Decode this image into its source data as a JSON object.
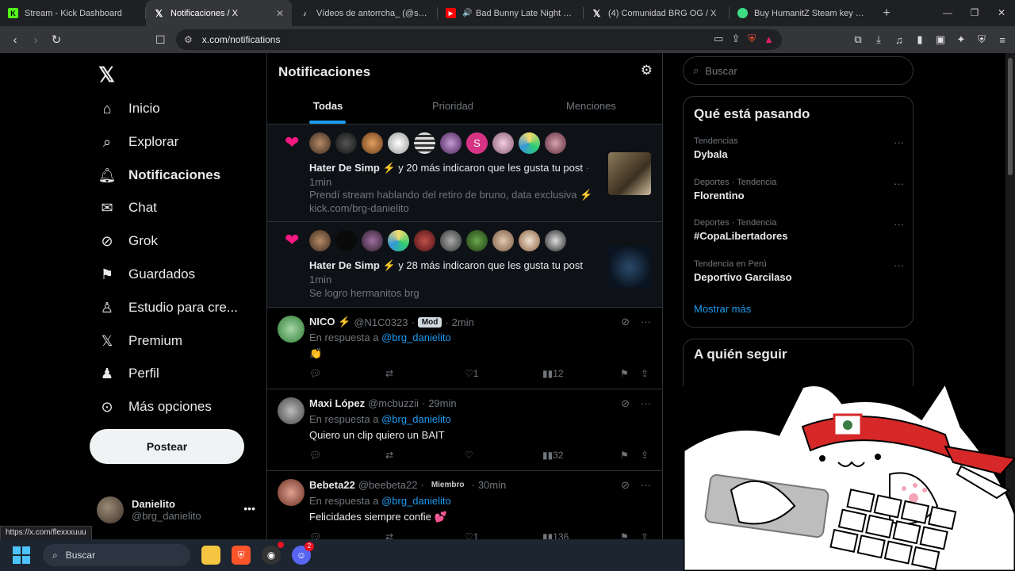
{
  "browser": {
    "tabs": [
      {
        "title": "Stream - Kick Dashboard",
        "icon": "kick-icon",
        "color": "#53fc18"
      },
      {
        "title": "Notificaciones / X",
        "icon": "x-icon",
        "color": "#ffffff",
        "active": true
      },
      {
        "title": "Vídeos de antorrcha_ (@seguidores)",
        "icon": "tiktok-icon",
        "color": "#ffffff"
      },
      {
        "title": "Bad Bunny Late Night Drive",
        "icon": "youtube-icon",
        "color": "#ff0000"
      },
      {
        "title": "(4) Comunidad BRG OG / X",
        "icon": "x-icon",
        "color": "#ffffff"
      },
      {
        "title": "Buy HumanitZ Steam key PC! Ch",
        "icon": "store-icon",
        "color": "#3ddc84"
      }
    ],
    "url": "x.com/notifications",
    "status_link": "https://x.com/flexxxuuu"
  },
  "nav": {
    "logo": "X",
    "items": [
      {
        "label": "Inicio",
        "icon": "home-icon"
      },
      {
        "label": "Explorar",
        "icon": "search-icon"
      },
      {
        "label": "Notificaciones",
        "icon": "bell-icon"
      },
      {
        "label": "Chat",
        "icon": "mail-icon"
      },
      {
        "label": "Grok",
        "icon": "grok-icon"
      },
      {
        "label": "Guardados",
        "icon": "bookmark-icon"
      },
      {
        "label": "Estudio para cre...",
        "icon": "studio-icon"
      },
      {
        "label": "Premium",
        "icon": "x-premium-icon"
      },
      {
        "label": "Perfil",
        "icon": "person-icon"
      },
      {
        "label": "Más opciones",
        "icon": "more-circle-icon"
      }
    ],
    "post_button": "Postear",
    "profile": {
      "name": "Danielito",
      "handle": "@brg_danielito"
    }
  },
  "main": {
    "title": "Notificaciones",
    "tabs": [
      "Todas",
      "Prioridad",
      "Menciones"
    ],
    "notifications": [
      {
        "type": "like",
        "actor": "Hater De Simp ⚡",
        "action": " y 20 más indicaron que les gusta tu post",
        "time": "1min",
        "text": "Prendí stream hablando del retiro de bruno, data exclusiva ⚡",
        "text2": "kick.com/brg-danielito"
      },
      {
        "type": "like",
        "actor": "Hater De Simp ⚡",
        "action": " y 28 más indicaron que les gusta tu post",
        "time": "1min",
        "text": "Se logro hermanitos brg"
      }
    ],
    "replies": [
      {
        "name": "NICO ⚡",
        "handle": "@N1C0323",
        "badge": "Mod",
        "time": "2min",
        "reply_to": "@brg_danielito",
        "text": "👏",
        "replies": "",
        "retweets": "",
        "likes": "1",
        "views": "12"
      },
      {
        "name": "Maxi López",
        "handle": "@mcbuzzii",
        "badge": "",
        "time": "29min",
        "reply_to": "@brg_danielito",
        "text": "Quiero un clip quiero un BAIT",
        "replies": "",
        "retweets": "",
        "likes": "",
        "views": "32"
      },
      {
        "name": "Bebeta22",
        "handle": "@beebeta22",
        "badge": "Miembro",
        "time": "30min",
        "reply_to": "@brg_danielito",
        "text": "Felicidades siempre confie 💕",
        "replies": "",
        "retweets": "",
        "likes": "1",
        "views": "136"
      }
    ],
    "reply_prefix": "En respuesta a "
  },
  "sidebar": {
    "search_placeholder": "Buscar",
    "trends_title": "Qué está pasando",
    "trends": [
      {
        "meta": "Tendencias",
        "name": "Dybala"
      },
      {
        "meta": "Deportes · Tendencia",
        "name": "Florentino"
      },
      {
        "meta": "Deportes · Tendencia",
        "name": "#CopaLibertadores"
      },
      {
        "meta": "Tendencia en Perú",
        "name": "Deportivo Garcilaso"
      }
    ],
    "show_more": "Mostrar más",
    "follow_title": "A quién seguir"
  },
  "taskbar": {
    "search": "Buscar",
    "discord_badge": "2"
  },
  "colors": {
    "accent": "#1d9bf0",
    "like": "#f91880",
    "background": "#000000"
  }
}
